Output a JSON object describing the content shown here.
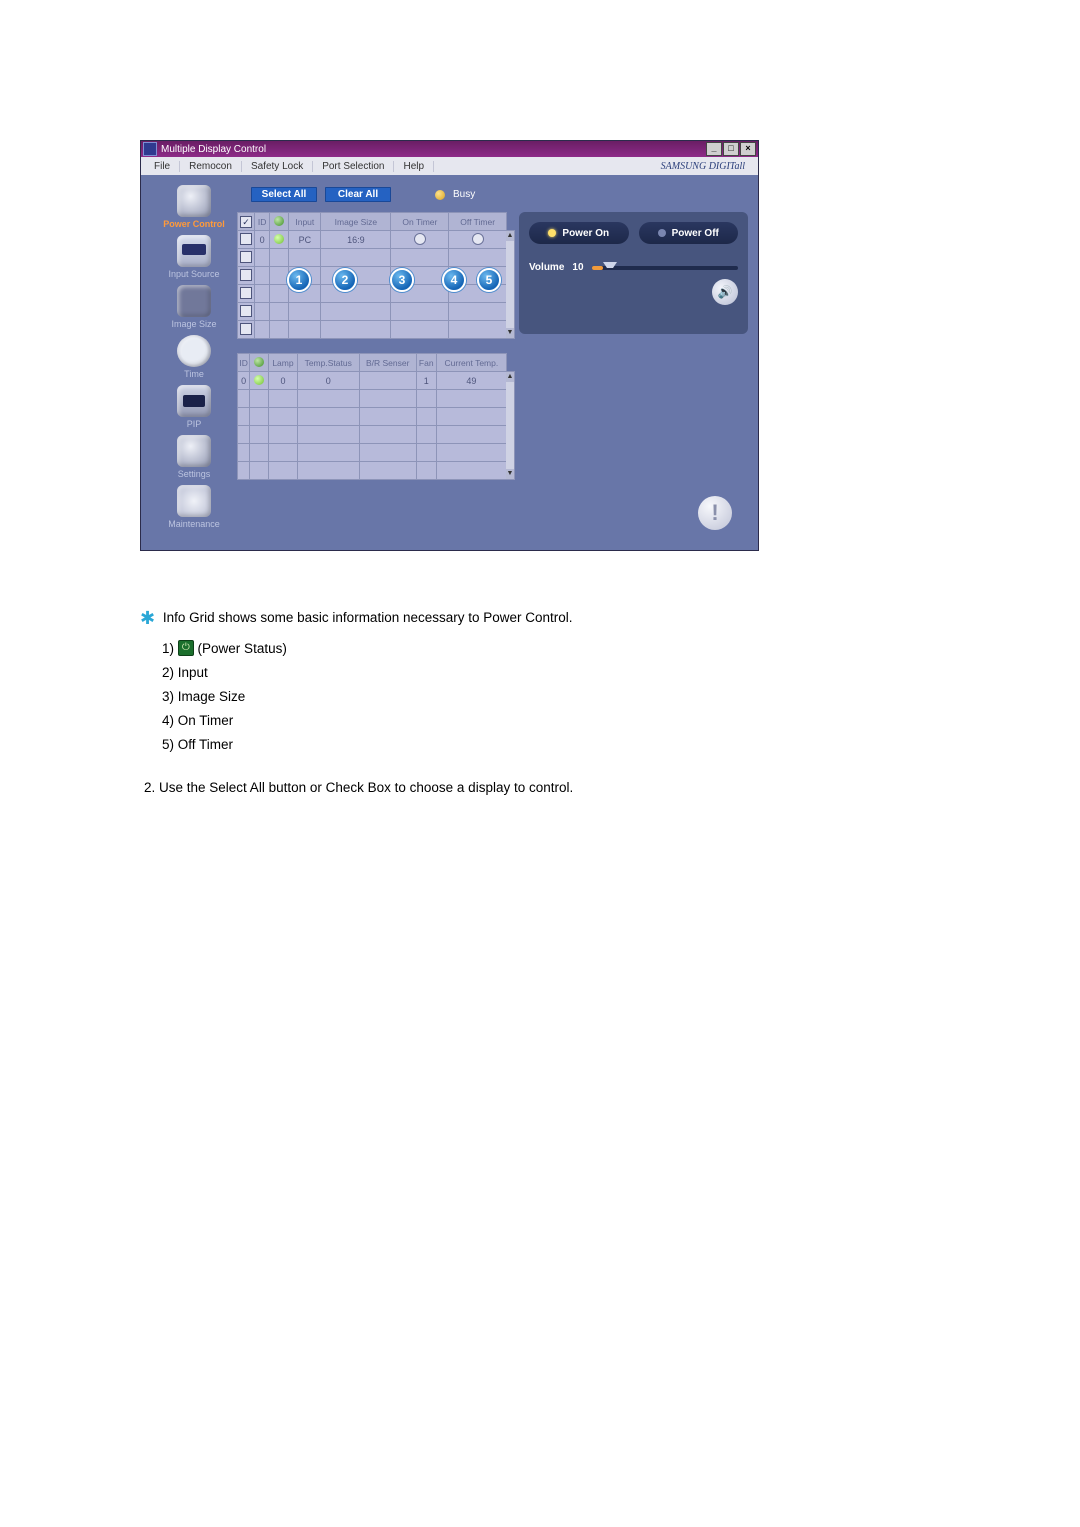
{
  "window": {
    "title": "Multiple Display Control",
    "brand": "SAMSUNG DIGITall",
    "buttons": {
      "min": "_",
      "max": "□",
      "close": "×"
    }
  },
  "menu": {
    "file": "File",
    "remocon": "Remocon",
    "safety": "Safety Lock",
    "port": "Port Selection",
    "help": "Help"
  },
  "sidebar": {
    "power": "Power Control",
    "input": "Input Source",
    "image": "Image Size",
    "time": "Time",
    "pip": "PIP",
    "settings": "Settings",
    "maint": "Maintenance"
  },
  "toolbar": {
    "select_all": "Select All",
    "clear_all": "Clear All",
    "busy": "Busy"
  },
  "grid1": {
    "headers": {
      "chk": "",
      "id": "ID",
      "power": "",
      "input": "Input",
      "size": "Image Size",
      "on": "On Timer",
      "off": "Off Timer"
    },
    "row": {
      "id": "0",
      "input": "PC",
      "size": "16:9"
    }
  },
  "grid2": {
    "headers": {
      "id": "ID",
      "power": "",
      "lamp": "Lamp",
      "temp": "Temp.Status",
      "br": "B/R Senser",
      "fan": "Fan",
      "cur": "Current Temp."
    },
    "row": {
      "id": "0",
      "lamp": "0",
      "temp": "0",
      "fan": "1",
      "cur": "49"
    }
  },
  "markers": {
    "m1": "1",
    "m2": "2",
    "m3": "3",
    "m4": "4",
    "m5": "5"
  },
  "panel": {
    "power_on": "Power On",
    "power_off": "Power Off",
    "volume_label": "Volume",
    "volume_value": "10"
  },
  "doc": {
    "intro": "Info Grid shows some basic information necessary to Power Control.",
    "li1": "1)",
    "li1_txt": "(Power Status)",
    "li2": "2) Input",
    "li3": "3) Image Size",
    "li4": "4) On Timer",
    "li5": "5) Off Timer",
    "step2": "2.  Use the Select All button or Check Box to choose a display to control."
  }
}
